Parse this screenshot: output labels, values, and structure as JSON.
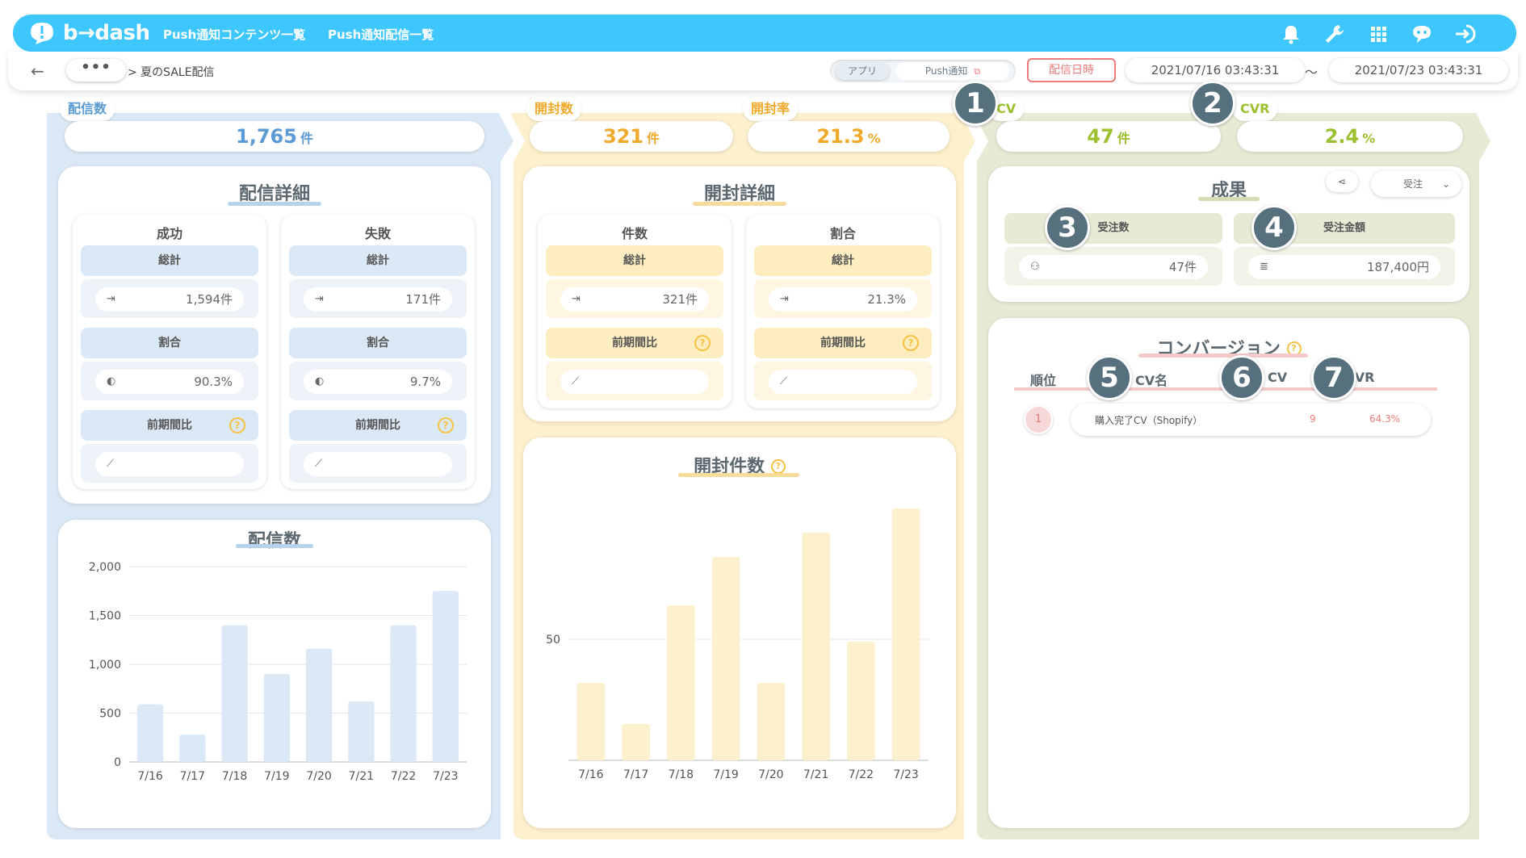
{
  "nav": {
    "logo": "b→dash",
    "links": [
      "Push通知コンテンツ一覧",
      "Push通知配信一覧"
    ],
    "icons": [
      "bell-icon",
      "wrench-icon",
      "apps-grid-icon",
      "chat-bot-icon",
      "logout-icon"
    ]
  },
  "subheader": {
    "breadcrumb": "> 夏のSALE配信",
    "segment_app": "アプリ",
    "segment_push": "Push通知",
    "date_type": "配信日時",
    "date_from": "2021/07/16 03:43:31",
    "tilde": "～",
    "date_to": "2021/07/23 03:43:31"
  },
  "delivery": {
    "tag": "配信数",
    "total": "1,765",
    "unit": "件",
    "detail_title": "配信詳細",
    "success": {
      "title": "成功",
      "total_label": "総計",
      "total": "1,594件",
      "ratio_label": "割合",
      "ratio": "90.3%",
      "change_label": "前期間比",
      "change": ""
    },
    "failure": {
      "title": "失敗",
      "total_label": "総計",
      "total": "171件",
      "ratio_label": "割合",
      "ratio": "9.7%",
      "change_label": "前期間比",
      "change": ""
    },
    "chart_title": "配信数"
  },
  "open": {
    "tag_count": "開封数",
    "tag_rate": "開封率",
    "count": "321",
    "count_unit": "件",
    "rate": "21.3",
    "rate_unit": "%",
    "detail_title": "開封詳細",
    "count_card": {
      "title": "件数",
      "total_label": "総計",
      "total": "321件",
      "change_label": "前期間比",
      "change": ""
    },
    "ratio_card": {
      "title": "割合",
      "total_label": "総計",
      "total": "21.3%",
      "change_label": "前期間比",
      "change": ""
    },
    "chart_title": "開封件数"
  },
  "conversion": {
    "tag_cv": "CV",
    "tag_cvr": "CVR",
    "cv": "47",
    "cv_unit": "件",
    "cvr": "2.4",
    "cvr_unit": "%",
    "result_title": "成果",
    "result_select": "受注",
    "orders_label": "受注数",
    "orders_value": "47件",
    "amount_label": "受注金額",
    "amount_value": "187,400円",
    "conv_title": "コンバージョン",
    "table_headers": [
      "順位",
      "CV名",
      "CV",
      "CVR"
    ],
    "rows": [
      {
        "rank": "1",
        "name": "購入完了CV（Shopify）",
        "cv": "9",
        "cvr": "64.3%"
      }
    ]
  },
  "badges": [
    "1",
    "2",
    "3",
    "4",
    "5",
    "6",
    "7"
  ],
  "colors": {
    "nav": "#3ec6ff",
    "blue": "#dbe9f6",
    "yellow": "#fdf0cc",
    "green": "#e7ebd5",
    "blue_text": "#5a9bd5",
    "yellow_text": "#f0a92a",
    "green_text": "#9bbf2e",
    "badge": "#56707e"
  },
  "chart_data": [
    {
      "type": "bar",
      "title": "配信数",
      "categories": [
        "7/16",
        "7/17",
        "7/18",
        "7/19",
        "7/20",
        "7/21",
        "7/22",
        "7/23"
      ],
      "values": [
        590,
        280,
        1400,
        900,
        1160,
        620,
        1400,
        1750
      ],
      "yticks": [
        "2,000",
        "1,500",
        "1,000",
        "500",
        "0"
      ],
      "ylim": [
        0,
        2000
      ],
      "color": "#dbe9f6"
    },
    {
      "type": "bar",
      "title": "開封件数",
      "categories": [
        "7/16",
        "7/17",
        "7/18",
        "7/19",
        "7/20",
        "7/21",
        "7/22",
        "7/23"
      ],
      "values": [
        32,
        15,
        64,
        84,
        32,
        94,
        49,
        104
      ],
      "yticks": [
        "50"
      ],
      "ytick_values": [
        50
      ],
      "ylim": [
        0,
        110
      ],
      "color": "#fdf0cc"
    }
  ]
}
